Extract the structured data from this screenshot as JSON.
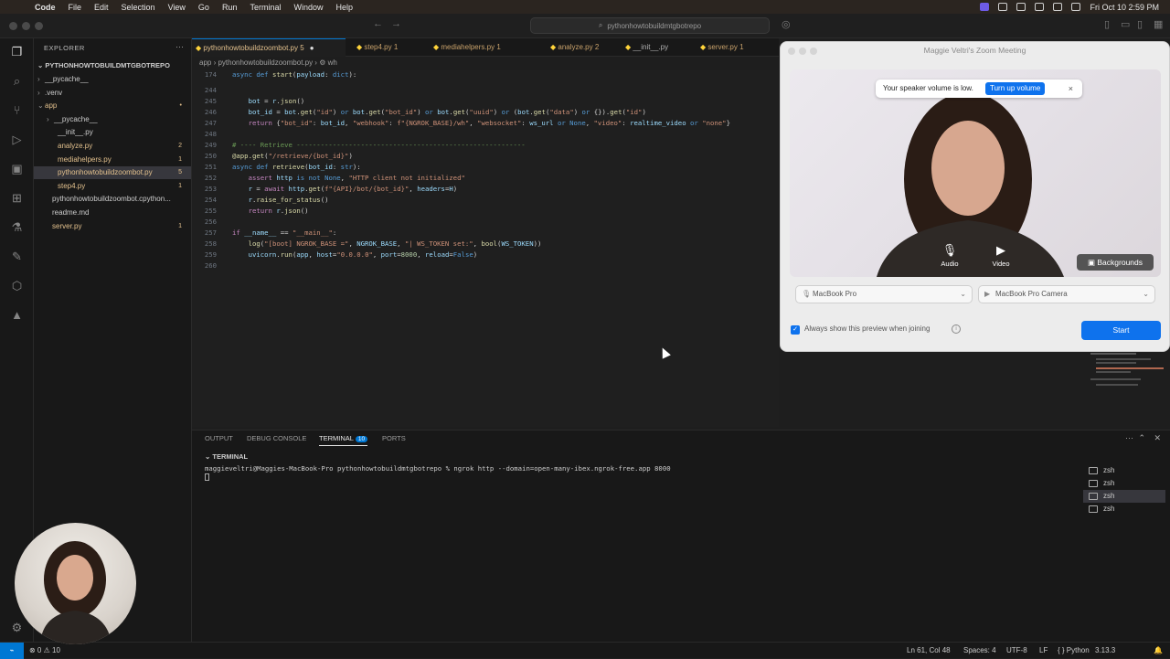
{
  "menubar": {
    "app": "Code",
    "menus": [
      "File",
      "Edit",
      "Selection",
      "View",
      "Go",
      "Run",
      "Terminal",
      "Window",
      "Help"
    ],
    "clock": "Fri Oct 10  2:59 PM"
  },
  "titlebar": {
    "search": "pythonhowtobuildmtgbotrepo"
  },
  "explorer": {
    "header": "EXPLORER",
    "root": "PYTHONHOWTOBUILDMTGBOTREPO",
    "items": [
      {
        "label": "__pycache__",
        "chev": "›",
        "indent": 12,
        "color": "gray",
        "badge": ""
      },
      {
        "label": ".venv",
        "chev": "›",
        "indent": 12,
        "color": "gray",
        "badge": ""
      },
      {
        "label": "app",
        "chev": "⌄",
        "indent": 12,
        "color": "yellow",
        "badge": "•"
      },
      {
        "label": "__pycache__",
        "chev": "›",
        "indent": 22,
        "color": "gray",
        "badge": ""
      },
      {
        "label": "__init__.py",
        "chev": "",
        "indent": 26,
        "color": "gray",
        "badge": ""
      },
      {
        "label": "analyze.py",
        "chev": "",
        "indent": 26,
        "color": "yellow",
        "badge": "2"
      },
      {
        "label": "mediahelpers.py",
        "chev": "",
        "indent": 26,
        "color": "yellow",
        "badge": "1"
      },
      {
        "label": "pythonhowtobuildzoombot.py",
        "chev": "",
        "indent": 26,
        "color": "yellow",
        "badge": "5"
      },
      {
        "label": "step4.py",
        "chev": "",
        "indent": 26,
        "color": "yellow",
        "badge": "1"
      },
      {
        "label": "pythonhowtobuildzoombot.cpython...",
        "chev": "",
        "indent": 20,
        "color": "gray",
        "badge": ""
      },
      {
        "label": "readme.md",
        "chev": "",
        "indent": 20,
        "color": "gray",
        "badge": ""
      },
      {
        "label": "server.py",
        "chev": "",
        "indent": 20,
        "color": "yellow",
        "badge": "1"
      }
    ]
  },
  "tabs": [
    {
      "label": "pythonhowtobuildzoombot.py",
      "badge": "5",
      "dirty": "●"
    },
    {
      "label": "step4.py",
      "badge": "1",
      "dirty": ""
    },
    {
      "label": "mediahelpers.py",
      "badge": "1",
      "dirty": ""
    },
    {
      "label": "analyze.py",
      "badge": "2",
      "dirty": ""
    },
    {
      "label": "__init__.py",
      "badge": "",
      "dirty": ""
    },
    {
      "label": "server.py",
      "badge": "1",
      "dirty": ""
    }
  ],
  "breadcrumb": "app  ›  pythonhowtobuildzoombot.py  ›  ⚙ wh",
  "code": {
    "lines": [
      {
        "n": "174",
        "html": "<span class=\"kw\">async def</span> <span class=\"fn\">start</span>(<span class=\"var\">payload</span>: <span class=\"kw\">dict</span>):"
      },
      {
        "n": "244",
        "html": ""
      },
      {
        "n": "245",
        "html": "    <span class=\"var\">bot</span> = <span class=\"var\">r</span>.<span class=\"fn\">json</span>()"
      },
      {
        "n": "246",
        "html": "    <span class=\"var\">bot_id</span> = <span class=\"var\">bot</span>.<span class=\"fn\">get</span>(<span class=\"str\">\"id\"</span>) <span class=\"kw\">or</span> <span class=\"var\">bot</span>.<span class=\"fn\">get</span>(<span class=\"str\">\"bot_id\"</span>) <span class=\"kw\">or</span> <span class=\"var\">bot</span>.<span class=\"fn\">get</span>(<span class=\"str\">\"uuid\"</span>) <span class=\"kw\">or</span> (<span class=\"var\">bot</span>.<span class=\"fn\">get</span>(<span class=\"str\">\"data\"</span>) <span class=\"kw\">or</span> {}).<span class=\"fn\">get</span>(<span class=\"str\">\"id\"</span>)"
      },
      {
        "n": "247",
        "html": "    <span class=\"kw2\">return</span> {<span class=\"str\">\"bot_id\"</span>: <span class=\"var\">bot_id</span>, <span class=\"str\">\"webhook\"</span>: <span class=\"str\">f\"{NGROK_BASE}/wh\"</span>, <span class=\"str\">\"websocket\"</span>: <span class=\"var\">ws_url</span> <span class=\"kw\">or</span> <span class=\"kw\">None</span>, <span class=\"str\">\"video\"</span>: <span class=\"var\">realtime_video</span> <span class=\"kw\">or</span> <span class=\"str\">\"none\"</span>}"
      },
      {
        "n": "248",
        "html": ""
      },
      {
        "n": "249",
        "html": "<span class=\"cmt\"># ---- Retrieve ---------------------------------------------------------</span>"
      },
      {
        "n": "250",
        "html": "<span class=\"fn\">@app.get</span>(<span class=\"str\">\"/retrieve/{bot_id}\"</span>)"
      },
      {
        "n": "251",
        "html": "<span class=\"kw\">async def</span> <span class=\"fn\">retrieve</span>(<span class=\"var\">bot_id</span>: <span class=\"kw\">str</span>):"
      },
      {
        "n": "252",
        "html": "    <span class=\"kw2\">assert</span> <span class=\"var\">http</span> <span class=\"kw\">is not None</span>, <span class=\"str\">\"HTTP client not initialized\"</span>"
      },
      {
        "n": "253",
        "html": "    <span class=\"var\">r</span> = <span class=\"kw2\">await</span> <span class=\"var\">http</span>.<span class=\"fn\">get</span>(<span class=\"str\">f\"{API}/bot/{bot_id}\"</span>, <span class=\"var\">headers</span>=<span class=\"var\">H</span>)"
      },
      {
        "n": "254",
        "html": "    <span class=\"var\">r</span>.<span class=\"fn\">raise_for_status</span>()"
      },
      {
        "n": "255",
        "html": "    <span class=\"kw2\">return</span> <span class=\"var\">r</span>.<span class=\"fn\">json</span>()"
      },
      {
        "n": "256",
        "html": ""
      },
      {
        "n": "257",
        "html": "<span class=\"kw2\">if</span> <span class=\"var\">__name__</span> == <span class=\"str\">\"__main__\"</span>:"
      },
      {
        "n": "258",
        "html": "    <span class=\"fn\">log</span>(<span class=\"str\">\"[boot] NGROK_BASE =\"</span>, <span class=\"var\">NGROK_BASE</span>, <span class=\"str\">\"| WS_TOKEN set:\"</span>, <span class=\"fn\">bool</span>(<span class=\"var\">WS_TOKEN</span>))"
      },
      {
        "n": "259",
        "html": "    <span class=\"var\">uvicorn</span>.<span class=\"fn\">run</span>(<span class=\"var\">app</span>, <span class=\"var\">host</span>=<span class=\"str\">\"0.0.0.0\"</span>, <span class=\"var\">port</span>=<span class=\"num\">8000</span>, <span class=\"var\">reload</span>=<span class=\"kw\">False</span>)"
      },
      {
        "n": "260",
        "html": ""
      }
    ]
  },
  "panel": {
    "tabs": [
      "OUTPUT",
      "DEBUG CONSOLE",
      "TERMINAL",
      "PORTS"
    ],
    "terminal_badge": "10",
    "terminal_label": "TERMINAL",
    "prompt": "maggieveltri@Maggies-MacBook-Pro pythonhowtobuildmtgbotrepo % ngrok http --domain=open-many-ibex.ngrok-free.app 8000",
    "shells": [
      "zsh",
      "zsh",
      "zsh",
      "zsh"
    ]
  },
  "statusbar": {
    "problems": "⊗ 0  ⚠ 10",
    "position": "Ln 61, Col 48",
    "spaces": "Spaces: 4",
    "encoding": "UTF-8",
    "eol": "LF",
    "language": "{ } Python",
    "version": "3.13.3"
  },
  "zoom": {
    "title": "Maggie Veltri's Zoom Meeting",
    "notice": "Your speaker volume is low.",
    "turn_up": "Turn up volume",
    "audio": "Audio",
    "video": "Video",
    "backgrounds": "Backgrounds",
    "mic_select": "MacBook Pro",
    "camera_select": "MacBook Pro Camera",
    "checkbox_label": "Always show this preview when joining",
    "start": "Start",
    "accent": "#0e72ed"
  }
}
